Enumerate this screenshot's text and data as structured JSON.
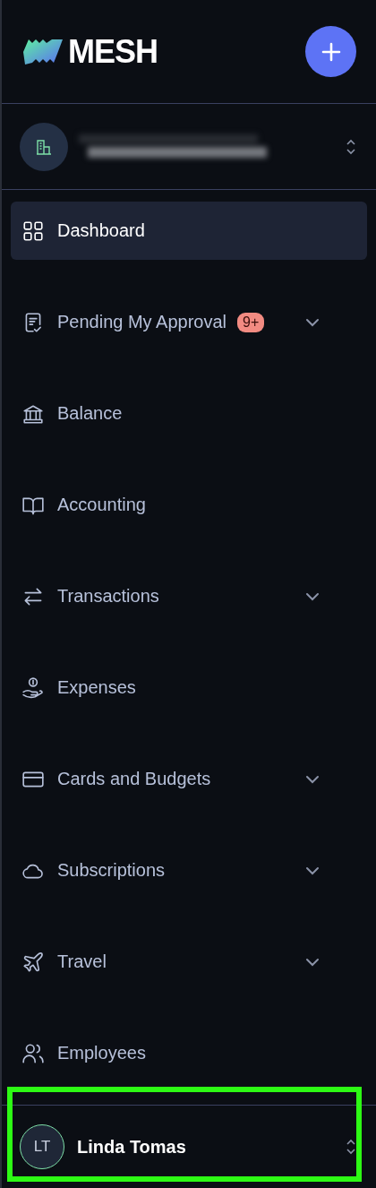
{
  "brand": {
    "name": "MESH"
  },
  "nav": [
    {
      "label": "Dashboard",
      "selected": true,
      "has_submenu": false
    },
    {
      "label": "Pending My Approval",
      "selected": false,
      "has_submenu": true,
      "badge": "9+"
    },
    {
      "label": "Balance",
      "selected": false,
      "has_submenu": false
    },
    {
      "label": "Accounting",
      "selected": false,
      "has_submenu": false
    },
    {
      "label": "Transactions",
      "selected": false,
      "has_submenu": true
    },
    {
      "label": "Expenses",
      "selected": false,
      "has_submenu": false
    },
    {
      "label": "Cards and Budgets",
      "selected": false,
      "has_submenu": true
    },
    {
      "label": "Subscriptions",
      "selected": false,
      "has_submenu": true
    },
    {
      "label": "Travel",
      "selected": false,
      "has_submenu": true
    },
    {
      "label": "Employees",
      "selected": false,
      "has_submenu": false
    }
  ],
  "user": {
    "initials": "LT",
    "name": "Linda Tomas",
    "highlighted": true
  }
}
